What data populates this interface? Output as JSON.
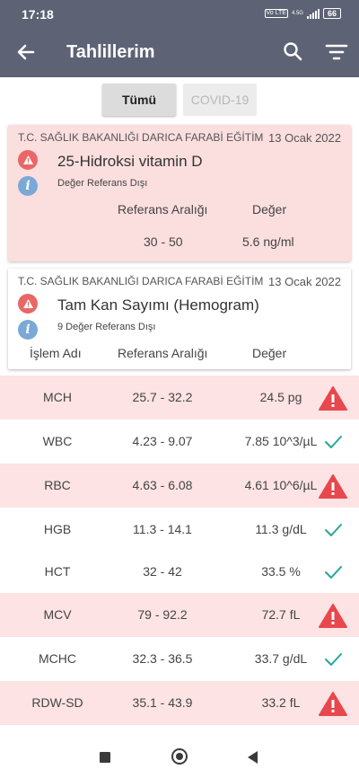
{
  "status_bar": {
    "time": "17:18",
    "network_badge": "Vo LTE",
    "network_type": "4.5G",
    "battery": "66"
  },
  "app_bar": {
    "title": "Tahlillerim"
  },
  "tabs": [
    {
      "label": "Tümü",
      "selected": true
    },
    {
      "label": "COVID-19",
      "selected": false
    }
  ],
  "cards": [
    {
      "institution": "T.C. SAĞLIK BAKANLIĞI DARICA FARABİ EĞİTİM",
      "date": "13 Ocak 2022",
      "test_name": "25-Hidroksi vitamin D",
      "note": "Değer Referans Dışı",
      "header_reference": "Referans Aralığı",
      "header_value": "Değer",
      "reference_range": "30 - 50",
      "value": "5.6 ng/ml"
    },
    {
      "institution": "T.C. SAĞLIK BAKANLIĞI DARICA FARABİ EĞİTİM",
      "date": "13 Ocak 2022",
      "test_name": "Tam Kan Sayımı (Hemogram)",
      "note": "9 Değer Referans Dışı",
      "header_name": "İşlem Adı",
      "header_reference": "Referans Aralığı",
      "header_value": "Değer"
    }
  ],
  "results": [
    {
      "name": "MCH",
      "range": "25.7 - 32.2",
      "value": "24.5 pg",
      "status": "warning"
    },
    {
      "name": "WBC",
      "range": "4.23 - 9.07",
      "value": "7.85 10^3/µL",
      "status": "ok"
    },
    {
      "name": "RBC",
      "range": "4.63 - 6.08",
      "value": "4.61 10^6/µL",
      "status": "warning"
    },
    {
      "name": "HGB",
      "range": "11.3 - 14.1",
      "value": "11.3 g/dL",
      "status": "ok"
    },
    {
      "name": "HCT",
      "range": "32 - 42",
      "value": "33.5 %",
      "status": "ok"
    },
    {
      "name": "MCV",
      "range": "79 - 92.2",
      "value": "72.7 fL",
      "status": "warning"
    },
    {
      "name": "MCHC",
      "range": "32.3 - 36.5",
      "value": "33.7 g/dL",
      "status": "ok"
    },
    {
      "name": "RDW-SD",
      "range": "35.1 - 43.9",
      "value": "33.2 fL",
      "status": "warning"
    }
  ],
  "colors": {
    "app_bar": "#5d6274",
    "warning": "#e8474d",
    "ok": "#26a69a",
    "out_of_range_row": "#fde3e3",
    "info": "#7aa9d6"
  },
  "icons": {
    "back": "arrow-left-icon",
    "search": "search-icon",
    "filter": "filter-icon",
    "warning": "warning-triangle-icon",
    "ok": "checkmark-icon",
    "info": "info-icon"
  }
}
